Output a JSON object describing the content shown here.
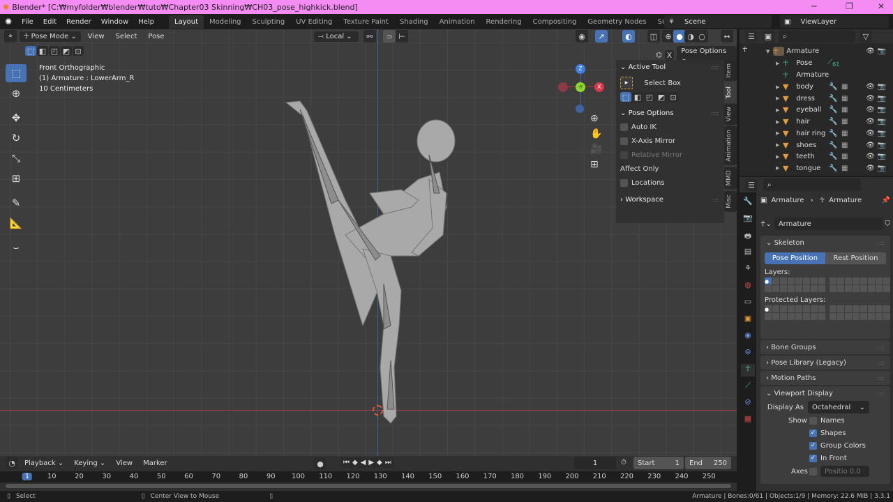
{
  "window": {
    "title": "Blender* [C:₩myfolder₩blender₩tuto₩Chapter03 Skinning₩CH03_pose_highkick.blend]",
    "minimize": "─",
    "maximize": "❐",
    "close": "✕"
  },
  "menu": [
    "File",
    "Edit",
    "Render",
    "Window",
    "Help"
  ],
  "workspaces": [
    "Layout",
    "Modeling",
    "Sculpting",
    "UV Editing",
    "Texture Paint",
    "Shading",
    "Animation",
    "Rendering",
    "Compositing",
    "Geometry Nodes",
    "Scripting",
    "+"
  ],
  "scene": "Scene",
  "view_layer": "ViewLayer",
  "viewport": {
    "mode": "Pose Mode",
    "menus": [
      "View",
      "Select",
      "Pose"
    ],
    "orientation": "Local",
    "pose_options": "Pose Options",
    "info": [
      "Front Orthographic",
      "(1) Armature : LowerArm_R",
      "10 Centimeters"
    ],
    "gizmo": {
      "z": "Z",
      "y": "-Y",
      "x": "X"
    }
  },
  "npanel": {
    "active_tool": "Active Tool",
    "tool_name": "Select Box",
    "pose_options": "Pose Options",
    "auto_ik": "Auto IK",
    "x_mirror": "X-Axis Mirror",
    "relative_mirror": "Relative Mirror",
    "affect_only": "Affect Only",
    "locations": "Locations",
    "workspace": "Workspace",
    "tabs": [
      "Item",
      "Tool",
      "View",
      "Animation",
      "MMD",
      "Misc"
    ]
  },
  "outliner": {
    "root": "Armature",
    "pose": "Pose",
    "pose_count": "61",
    "armature_data": "Armature",
    "children": [
      "body",
      "dress",
      "eyeball",
      "hair",
      "hair ring",
      "shoes",
      "teeth",
      "tongue"
    ]
  },
  "properties": {
    "breadcrumb": [
      "Armature",
      "Armature"
    ],
    "data_name": "Armature",
    "skeleton": "Skeleton",
    "pose_position": "Pose Position",
    "rest_position": "Rest Position",
    "layers": "Layers:",
    "protected_layers": "Protected Layers:",
    "bone_groups": "Bone Groups",
    "pose_library": "Pose Library (Legacy)",
    "motion_paths": "Motion Paths",
    "viewport_display": "Viewport Display",
    "display_as_label": "Display As",
    "display_as": "Octahedral",
    "show": "Show",
    "names": "Names",
    "shapes": "Shapes",
    "group_colors": "Group Colors",
    "in_front": "In Front",
    "axes": "Axes",
    "axes_position": "Positio  0.0",
    "checks": {
      "names": false,
      "shapes": true,
      "group_colors": true,
      "in_front": true,
      "axes": false
    }
  },
  "timeline": {
    "menus": [
      "Playback",
      "Keying",
      "View",
      "Marker"
    ],
    "current_frame": "1",
    "start_label": "Start",
    "start": "1",
    "end_label": "End",
    "end": "250",
    "ticks": [
      "1",
      "10",
      "20",
      "30",
      "40",
      "50",
      "60",
      "70",
      "80",
      "90",
      "100",
      "110",
      "120",
      "130",
      "140",
      "150",
      "160",
      "170",
      "180",
      "190",
      "200",
      "210",
      "220",
      "230",
      "240",
      "250"
    ]
  },
  "status": {
    "select": "Select",
    "center": "Center View to Mouse",
    "info": "Armature | Bones:0/61 | Objects:1/9 | Memory: 22.6 MiB | 3.3.1"
  }
}
